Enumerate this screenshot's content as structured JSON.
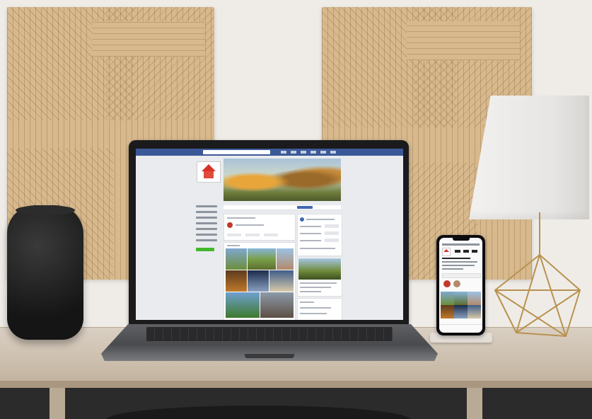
{
  "scene": {
    "description_free": true
  },
  "laptop_page": {
    "page_name": "",
    "sidebar_items": [
      "",
      "",
      "",
      "",
      "",
      "",
      "",
      "",
      ""
    ]
  },
  "colors": {
    "facebook_blue": "#3b5998",
    "button_green": "#42b72a",
    "logo_red": "#d8332a"
  },
  "icons": [
    "house-logo-icon",
    "search-icon"
  ]
}
